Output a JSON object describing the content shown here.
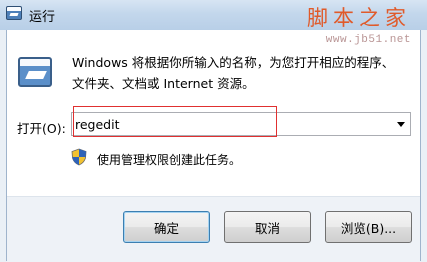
{
  "window": {
    "title": "运行"
  },
  "watermark": {
    "site_name": "脚本之家",
    "url": "www.jb51.net"
  },
  "dialog": {
    "icon": "run-icon",
    "description_line1": "Windows 将根据你所输入的名称，为您打开相应的程序、",
    "description_line2": "文件夹、文档或 Internet 资源。",
    "open_label": "打开(O):",
    "command_value": "regedit",
    "admin_note": "使用管理权限创建此任务。",
    "highlight_color": "#e03030"
  },
  "buttons": {
    "ok": "确定",
    "cancel": "取消",
    "browse": "浏览(B)..."
  }
}
